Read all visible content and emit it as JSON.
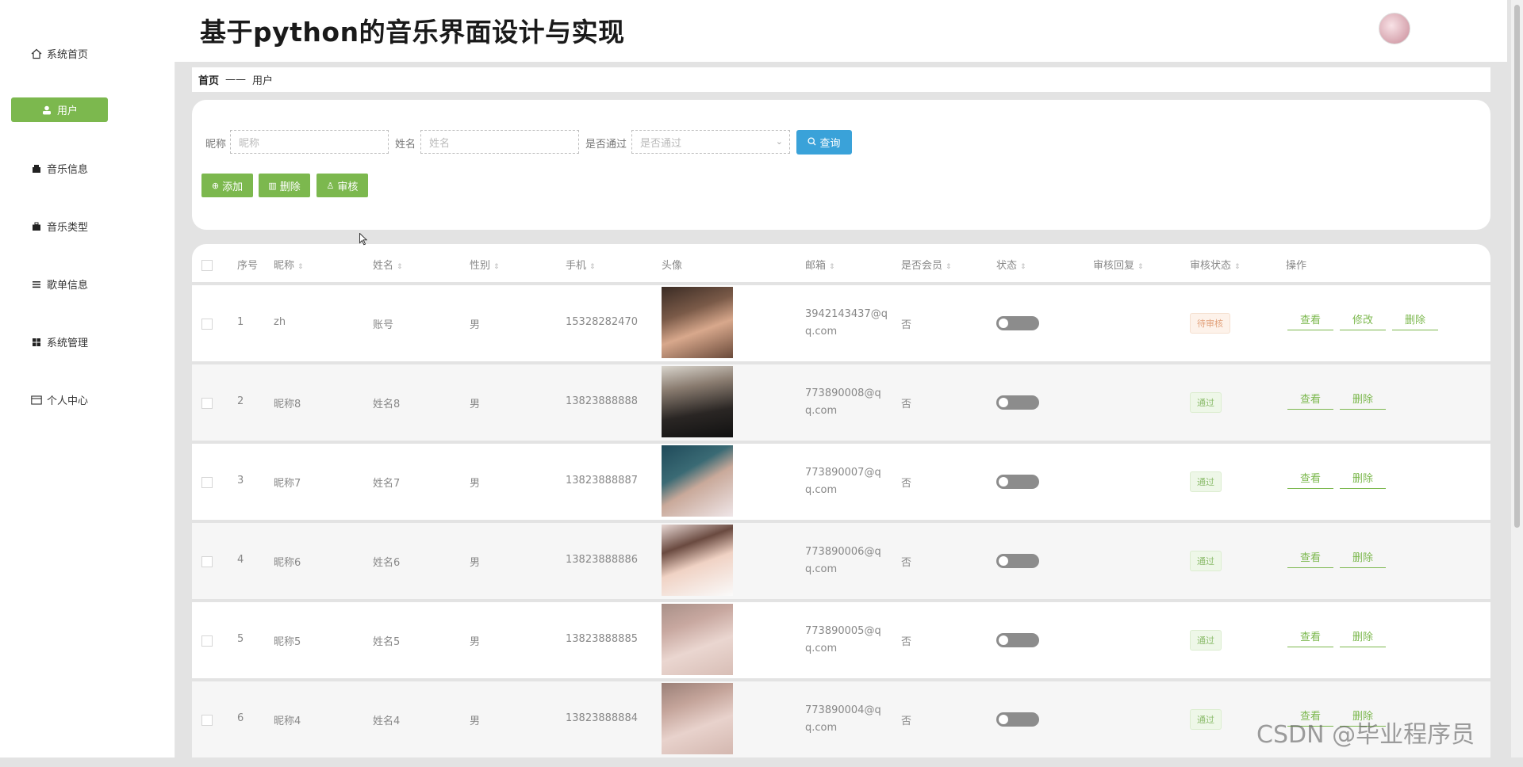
{
  "app": {
    "title": "基于python的音乐界面设计与实现"
  },
  "sidebar": {
    "items": [
      {
        "label": "系统首页",
        "icon": "home-icon",
        "active": false
      },
      {
        "label": "用户",
        "icon": "user-icon",
        "active": true
      },
      {
        "label": "音乐信息",
        "icon": "music-info-icon",
        "active": false
      },
      {
        "label": "音乐类型",
        "icon": "briefcase-icon",
        "active": false
      },
      {
        "label": "歌单信息",
        "icon": "list-icon",
        "active": false
      },
      {
        "label": "系统管理",
        "icon": "grid-icon",
        "active": false
      },
      {
        "label": "个人中心",
        "icon": "card-icon",
        "active": false
      }
    ]
  },
  "breadcrumb": {
    "home": "首页",
    "separator": "——",
    "current": "用户"
  },
  "search": {
    "nickname_label": "昵称",
    "nickname_placeholder": "昵称",
    "name_label": "姓名",
    "name_placeholder": "姓名",
    "passed_label": "是否通过",
    "passed_placeholder": "是否通过",
    "search_button": "查询"
  },
  "toolbar": {
    "add": "添加",
    "delete": "删除",
    "review": "审核"
  },
  "table": {
    "columns": [
      "序号",
      "昵称",
      "姓名",
      "性别",
      "手机",
      "头像",
      "邮箱",
      "是否会员",
      "状态",
      "审核回复",
      "审核状态",
      "操作"
    ],
    "actions": {
      "view": "查看",
      "edit": "修改",
      "delete": "删除"
    },
    "rows": [
      {
        "index": "1",
        "nickname": "zh",
        "name": "账号",
        "gender": "男",
        "phone": "15328282470",
        "email": "3942143437@qq.com",
        "member": "否",
        "status_on": false,
        "reply": "",
        "review": "待审核",
        "review_type": "pending",
        "can_edit": true
      },
      {
        "index": "2",
        "nickname": "昵称8",
        "name": "姓名8",
        "gender": "男",
        "phone": "13823888888",
        "email": "773890008@qq.com",
        "member": "否",
        "status_on": false,
        "reply": "",
        "review": "通过",
        "review_type": "pass",
        "can_edit": false
      },
      {
        "index": "3",
        "nickname": "昵称7",
        "name": "姓名7",
        "gender": "男",
        "phone": "13823888887",
        "email": "773890007@qq.com",
        "member": "否",
        "status_on": false,
        "reply": "",
        "review": "通过",
        "review_type": "pass",
        "can_edit": false
      },
      {
        "index": "4",
        "nickname": "昵称6",
        "name": "姓名6",
        "gender": "男",
        "phone": "13823888886",
        "email": "773890006@qq.com",
        "member": "否",
        "status_on": false,
        "reply": "",
        "review": "通过",
        "review_type": "pass",
        "can_edit": false
      },
      {
        "index": "5",
        "nickname": "昵称5",
        "name": "姓名5",
        "gender": "男",
        "phone": "13823888885",
        "email": "773890005@qq.com",
        "member": "否",
        "status_on": false,
        "reply": "",
        "review": "通过",
        "review_type": "pass",
        "can_edit": false
      },
      {
        "index": "6",
        "nickname": "昵称4",
        "name": "姓名4",
        "gender": "男",
        "phone": "13823888884",
        "email": "773890004@qq.com",
        "member": "否",
        "status_on": false,
        "reply": "",
        "review": "通过",
        "review_type": "pass",
        "can_edit": false
      }
    ]
  },
  "watermark": "CSDN @毕业程序员",
  "colors": {
    "accent_green": "#7cb84e",
    "search_blue": "#3aa2d9",
    "pending": "#e2a27c",
    "pass": "#8cbc6c"
  }
}
